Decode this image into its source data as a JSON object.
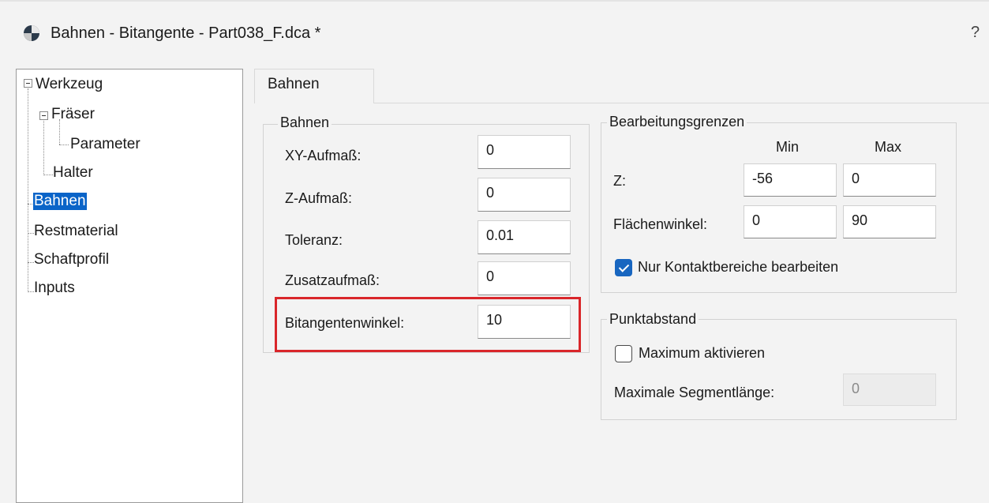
{
  "window": {
    "title": "Bahnen - Bitangente - Part038_F.dca *",
    "help_label": "?"
  },
  "tree": {
    "items": [
      {
        "label": "Werkzeug",
        "expanded": true
      },
      {
        "label": "Fräser",
        "expanded": true
      },
      {
        "label": "Parameter"
      },
      {
        "label": "Halter"
      },
      {
        "label": "Bahnen",
        "selected": true
      },
      {
        "label": "Restmaterial"
      },
      {
        "label": "Schaftprofil"
      },
      {
        "label": "Inputs"
      }
    ]
  },
  "tabs": [
    {
      "label": "Bahnen",
      "active": true
    }
  ],
  "bahnen_group": {
    "title": "Bahnen",
    "fields": [
      {
        "label": "XY-Aufmaß:",
        "value": "0"
      },
      {
        "label": "Z-Aufmaß:",
        "value": "0"
      },
      {
        "label": "Toleranz:",
        "value": "0.01"
      },
      {
        "label": "Zusatzaufmaß:",
        "value": "0"
      },
      {
        "label": "Bitangentenwinkel:",
        "value": "10",
        "highlighted": true
      }
    ]
  },
  "grenzen_group": {
    "title": "Bearbeitungsgrenzen",
    "col_min": "Min",
    "col_max": "Max",
    "rows": [
      {
        "label": "Z:",
        "min": "-56",
        "max": "0"
      },
      {
        "label": "Flächenwinkel:",
        "min": "0",
        "max": "90"
      }
    ],
    "checkbox": {
      "label": "Nur Kontaktbereiche bearbeiten",
      "checked": true
    }
  },
  "punkt_group": {
    "title": "Punktabstand",
    "checkbox": {
      "label": "Maximum aktivieren",
      "checked": false
    },
    "segment_label": "Maximale Segmentlänge:",
    "segment_value": "0",
    "segment_enabled": false
  },
  "colors": {
    "selection": "#0a64c8",
    "highlight": "#d9262a",
    "checkbox_checked": "#1866c0"
  }
}
